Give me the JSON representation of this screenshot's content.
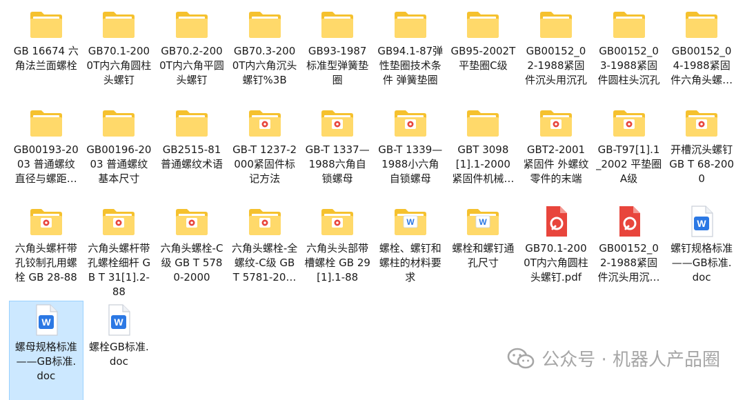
{
  "files": [
    {
      "label": "GB 16674 六角法兰面螺栓",
      "icon": "folder-icon"
    },
    {
      "label": "GB70.1-2000T内六角圆柱头螺钉",
      "icon": "folder-icon"
    },
    {
      "label": "GB70.2-2000T内六角平圆头螺钉",
      "icon": "folder-icon"
    },
    {
      "label": "GB70.3-2000T内六角沉头螺钉%3B",
      "icon": "folder-icon"
    },
    {
      "label": "GB93-1987标准型弹簧垫圈",
      "icon": "folder-icon"
    },
    {
      "label": "GB94.1-87弹性垫圈技术条件 弹簧垫圈",
      "icon": "folder-icon"
    },
    {
      "label": "GB95-2002T平垫圈C级",
      "icon": "folder-icon"
    },
    {
      "label": "GB00152_02-1988紧固件沉头用沉孔",
      "icon": "folder-icon"
    },
    {
      "label": "GB00152_03-1988紧固件圆柱头沉孔",
      "icon": "folder-icon"
    },
    {
      "label": "GB00152_04-1988紧固件六角头螺…",
      "icon": "folder-icon"
    },
    {
      "label": "GB00193-2003 普通螺纹 直径与螺距…",
      "icon": "folder-icon"
    },
    {
      "label": "GB00196-2003 普通螺纹 基本尺寸",
      "icon": "folder-icon"
    },
    {
      "label": "GB2515-81普通螺纹术语",
      "icon": "folder-icon"
    },
    {
      "label": "GB-T 1237-2000紧固件标记方法",
      "icon": "folder-pdf-icon"
    },
    {
      "label": "GB-T 1337—1988六角自锁螺母",
      "icon": "folder-pdf-icon"
    },
    {
      "label": "GB-T 1339—1988小六角自锁螺母",
      "icon": "folder-pdf-icon"
    },
    {
      "label": "GBT 3098[1].1-2000 紧固件机械…",
      "icon": "folder-icon"
    },
    {
      "label": "GBT2-2001紧固件 外螺纹零件的末端",
      "icon": "folder-pdf-icon"
    },
    {
      "label": "GB-T97[1].1_2002 平垫圈A级",
      "icon": "folder-pdf-icon"
    },
    {
      "label": "开槽沉头螺钉 GB T 68-2000",
      "icon": "folder-pdf-icon"
    },
    {
      "label": "六角头螺杆带孔铰制孔用螺栓 GB 28-88",
      "icon": "folder-pdf-icon"
    },
    {
      "label": "六角头螺杆带孔螺栓细杆 GB T 31[1].2-88",
      "icon": "folder-pdf-icon"
    },
    {
      "label": "六角头螺栓-C级 GB T 5780-2000",
      "icon": "folder-pdf-icon"
    },
    {
      "label": "六角头螺栓-全螺纹-C级 GB T 5781-20…",
      "icon": "folder-pdf-icon"
    },
    {
      "label": "六角头头部带槽螺栓 GB 29[1].1-88",
      "icon": "folder-pdf-icon"
    },
    {
      "label": "螺栓、螺钉和螺柱的材料要求",
      "icon": "folder-word-icon"
    },
    {
      "label": "螺栓和螺钉通孔尺寸",
      "icon": "folder-word-icon"
    },
    {
      "label": "GB70.1-2000T内六角圆柱头螺钉.pdf",
      "icon": "pdf-file-icon"
    },
    {
      "label": "GB00152_02-1988紧固件沉头用沉…",
      "icon": "pdf-file-icon"
    },
    {
      "label": "螺钉规格标准——GB标准.doc",
      "icon": "word-file-icon"
    },
    {
      "label": "螺母规格标准——GB标准.doc",
      "icon": "word-file-icon",
      "selected": true
    },
    {
      "label": "螺栓GB标准.doc",
      "icon": "word-file-icon"
    }
  ],
  "watermark": {
    "text": "公众号 · 机器人产品圈",
    "icon": "wechat-icon"
  },
  "colors": {
    "folder_back": "#f5c12e",
    "folder_front": "#ffd96a",
    "pdf_red": "#e8453c",
    "word_blue": "#2b78e4",
    "selection_bg": "#cce8ff"
  }
}
